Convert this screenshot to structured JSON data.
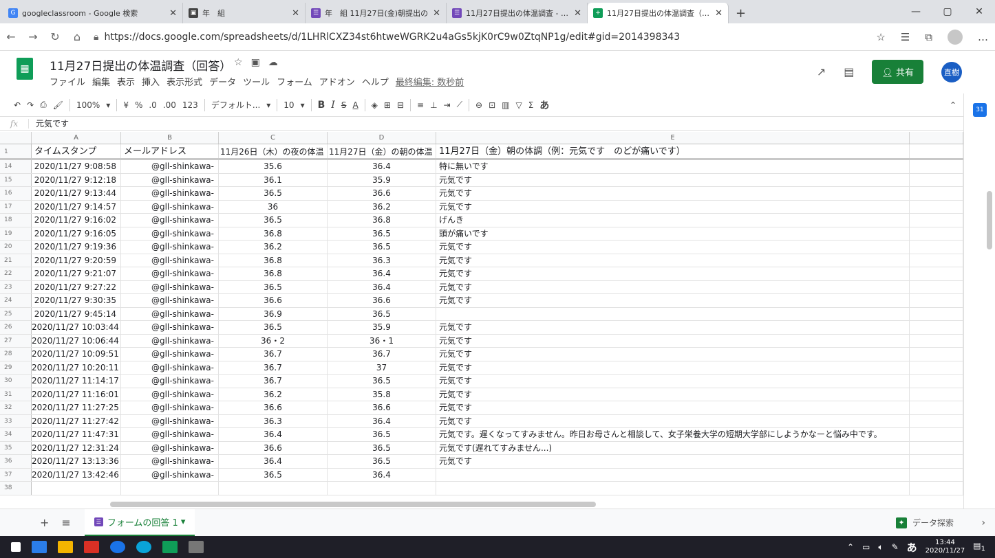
{
  "browser": {
    "tabs": [
      {
        "title": "googleclassroom - Google 検索",
        "favicon": "G",
        "color": "#4285f4"
      },
      {
        "title": "年　組",
        "favicon": "▣",
        "color": "#444"
      },
      {
        "title": "年　組 11月27日(金)朝提出の",
        "favicon": "☰",
        "color": "#7248b9"
      },
      {
        "title": "11月27日提出の体温調査 - Goog",
        "favicon": "☰",
        "color": "#7248b9"
      },
      {
        "title": "11月27日提出の体温調査（回答）",
        "favicon": "+",
        "color": "#0f9d58"
      }
    ],
    "url": "https://docs.google.com/spreadsheets/d/1LHRlCXZ34st6htweWGRK2u4aGs5kjK0rC9w0ZtqNP1g/edit#gid=2014398343"
  },
  "doc": {
    "title": "11月27日提出の体温調査（回答）",
    "menus": [
      "ファイル",
      "編集",
      "表示",
      "挿入",
      "表示形式",
      "データ",
      "ツール",
      "フォーム",
      "アドオン",
      "ヘルプ"
    ],
    "last_edit": "最終編集: 数秒前",
    "share_label": "共有",
    "user_initials": "直樹"
  },
  "toolbar": {
    "zoom": "100%",
    "currency": "¥",
    "percent": "%",
    "dec_minus": ".0",
    "dec_plus": ".00",
    "format123": "123",
    "font": "デフォルト...",
    "size": "10",
    "bold": "B",
    "italic": "I",
    "strike": "S",
    "color_a": "A",
    "ime": "あ"
  },
  "formula_bar": {
    "fx": "fx",
    "value": "元気です"
  },
  "columns": [
    "A",
    "B",
    "C",
    "D",
    "E"
  ],
  "header_row": {
    "num": "1",
    "a": "タイムスタンプ",
    "b": "メールアドレス",
    "c": "11月26日（木）の夜の体温",
    "d": "11月27日（金）の朝の体温",
    "e": "11月27日（金）朝の体調（例：元気です　のどが痛いです）"
  },
  "rows": [
    [
      "14",
      "2020/11/27 9:08:58",
      "@gll-shinkawa-",
      "35.6",
      "36.4",
      "特に無いです"
    ],
    [
      "15",
      "2020/11/27 9:12:18",
      "@gll-shinkawa-",
      "36.1",
      "35.9",
      "元気です"
    ],
    [
      "16",
      "2020/11/27 9:13:44",
      "@gll-shinkawa-",
      "36.5",
      "36.6",
      "元気です"
    ],
    [
      "17",
      "2020/11/27 9:14:57",
      "@gll-shinkawa-",
      "36",
      "36.2",
      "元気です"
    ],
    [
      "18",
      "2020/11/27 9:16:02",
      "@gll-shinkawa-",
      "36.5",
      "36.8",
      "げんき"
    ],
    [
      "19",
      "2020/11/27 9:16:05",
      "@gll-shinkawa-",
      "36.8",
      "36.5",
      "頭が痛いです"
    ],
    [
      "20",
      "2020/11/27 9:19:36",
      "@gll-shinkawa-",
      "36.2",
      "36.5",
      "元気です"
    ],
    [
      "21",
      "2020/11/27 9:20:59",
      "@gll-shinkawa-",
      "36.8",
      "36.3",
      "元気です"
    ],
    [
      "22",
      "2020/11/27 9:21:07",
      "@gll-shinkawa-",
      "36.8",
      "36.4",
      "元気です"
    ],
    [
      "23",
      "2020/11/27 9:27:22",
      "@gll-shinkawa-",
      "36.5",
      "36.4",
      "元気です"
    ],
    [
      "24",
      "2020/11/27 9:30:35",
      "@gll-shinkawa-",
      "36.6",
      "36.6",
      "元気です"
    ],
    [
      "25",
      "2020/11/27 9:45:14",
      "@gll-shinkawa-",
      "36.9",
      "36.5",
      ""
    ],
    [
      "26",
      "2020/11/27 10:03:44",
      "@gll-shinkawa-",
      "36.5",
      "35.9",
      "元気です"
    ],
    [
      "27",
      "2020/11/27 10:06:44",
      "@gll-shinkawa-",
      "36・2",
      "36・1",
      "元気です"
    ],
    [
      "28",
      "2020/11/27 10:09:51",
      "@gll-shinkawa-",
      "36.7",
      "36.7",
      "元気です"
    ],
    [
      "29",
      "2020/11/27 10:20:11",
      "@gll-shinkawa-",
      "36.7",
      "37",
      "元気です"
    ],
    [
      "30",
      "2020/11/27 11:14:17",
      "@gll-shinkawa-",
      "36.7",
      "36.5",
      "元気です"
    ],
    [
      "31",
      "2020/11/27 11:16:01",
      "@gll-shinkawa-",
      "36.2",
      "35.8",
      "元気です"
    ],
    [
      "32",
      "2020/11/27 11:27:25",
      "@gll-shinkawa-",
      "36.6",
      "36.6",
      "元気です"
    ],
    [
      "33",
      "2020/11/27 11:27:42",
      "@gll-shinkawa-",
      "36.3",
      "36.4",
      "元気です"
    ],
    [
      "34",
      "2020/11/27 11:47:31",
      "@gll-shinkawa-",
      "36.4",
      "36.5",
      "元気です。遅くなってすみません。昨日お母さんと相談して、女子栄養大学の短期大学部にしようかなーと悩み中です。"
    ],
    [
      "35",
      "2020/11/27 12:31:24",
      "@gll-shinkawa-",
      "36.6",
      "36.5",
      "元気です(遅れてすみません...)"
    ],
    [
      "36",
      "2020/11/27 13:13:36",
      "@gll-shinkawa-",
      "36.4",
      "36.5",
      "元気です"
    ],
    [
      "37",
      "2020/11/27 13:42:46",
      "@gll-shinkawa-",
      "36.5",
      "36.4",
      ""
    ],
    [
      "38",
      "",
      "",
      "",
      "",
      ""
    ]
  ],
  "sheet": {
    "tab_label": "フォームの回答 1",
    "explore": "データ探索"
  },
  "taskbar": {
    "time": "13:44",
    "date": "2020/11/27",
    "ime": "あ",
    "notif": "1"
  }
}
